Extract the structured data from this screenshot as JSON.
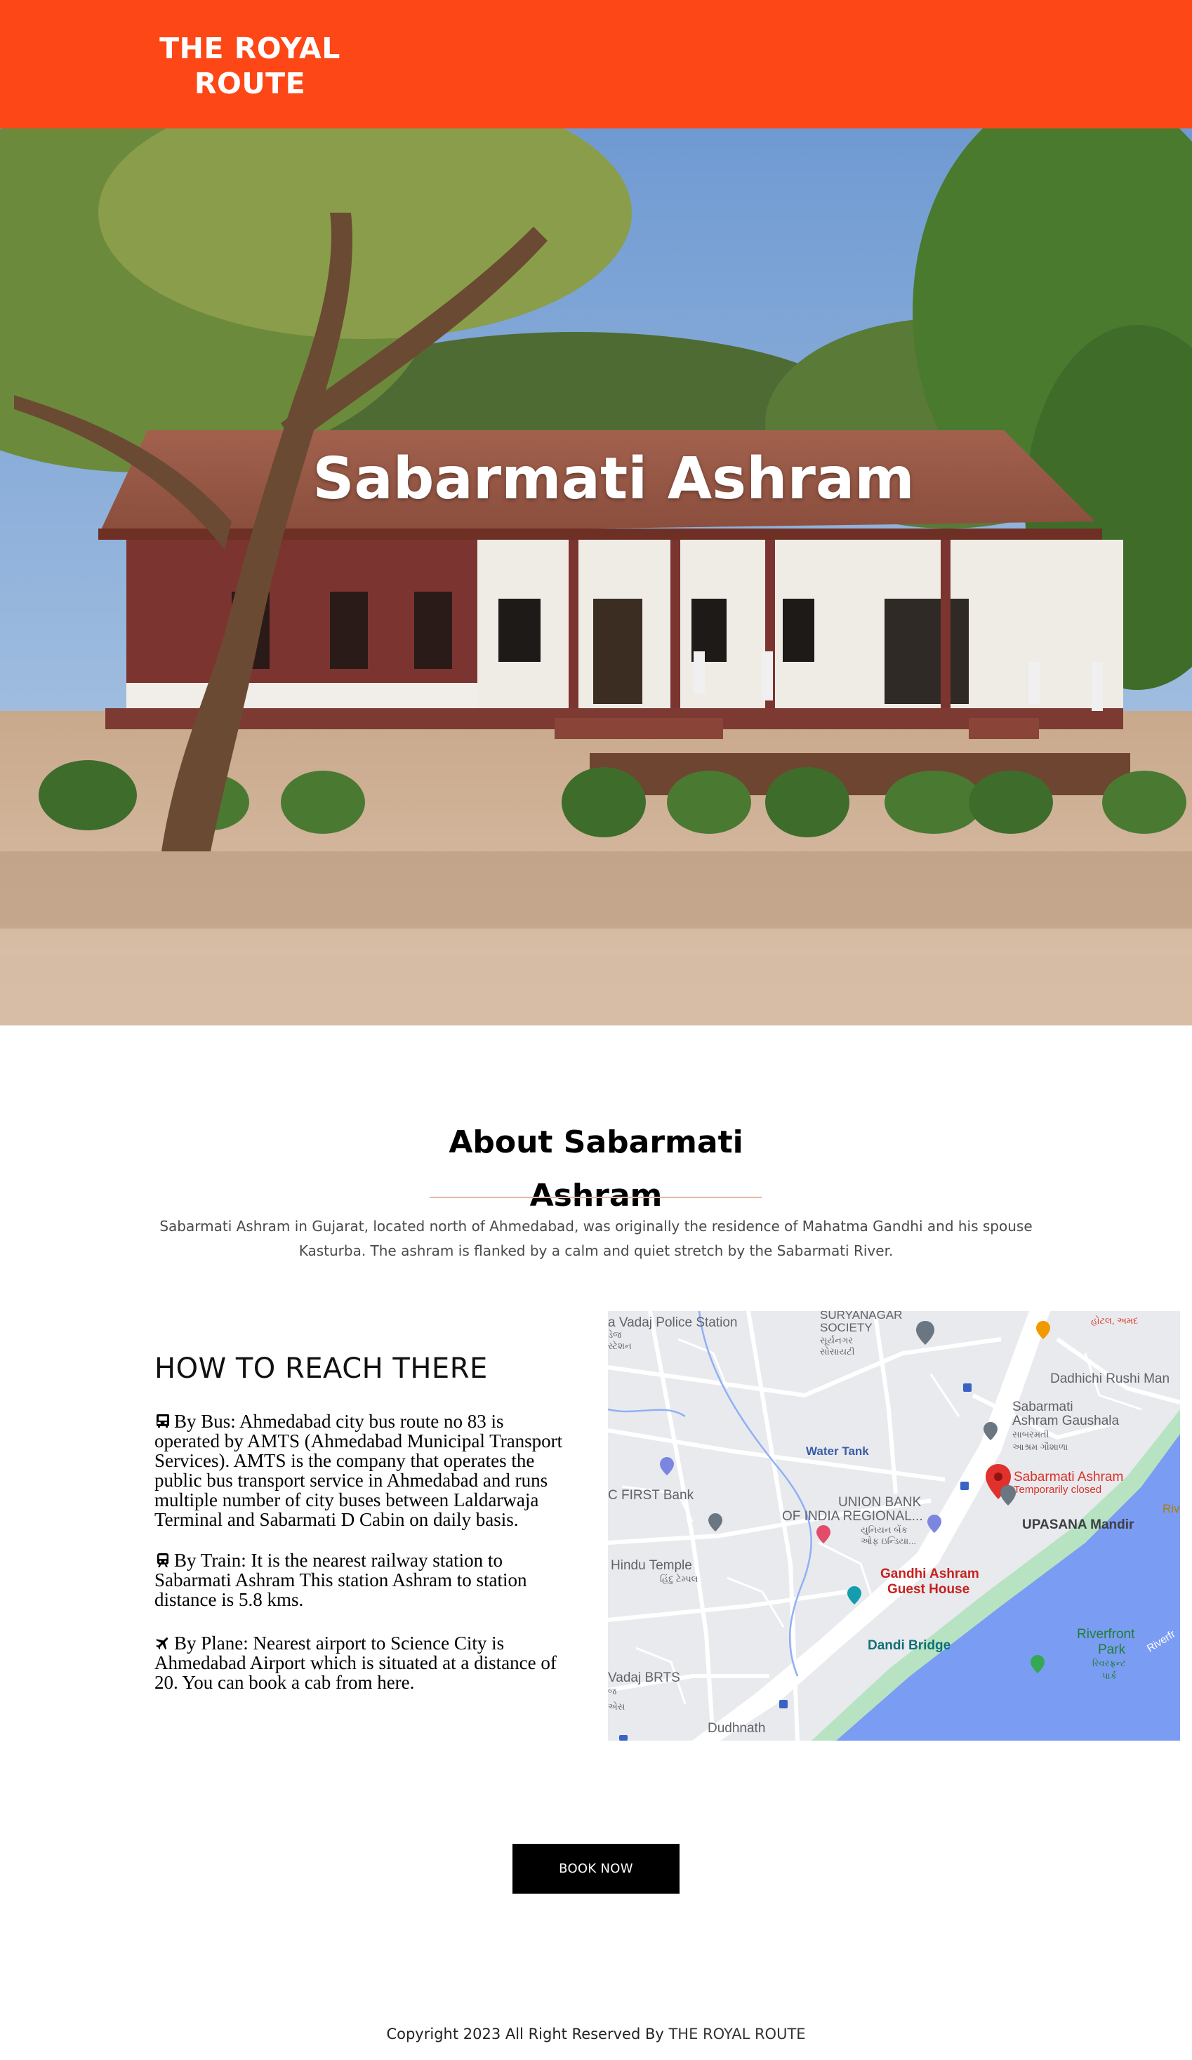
{
  "header": {
    "logo_line1": "THE ROYAL",
    "logo_line2": "ROUTE",
    "background_color": "#fd4716"
  },
  "hero": {
    "title": "Sabarmati Ashram"
  },
  "about": {
    "title_line1": "About Sabarmati",
    "title_line2": "Ashram",
    "text_line1": "Sabarmati Ashram in Gujarat, located north of Ahmedabad, was originally the residence of Mahatma Gandhi and his spouse",
    "text_line2": "Kasturba. The ashram is flanked by a calm and quiet stretch by the Sabarmati River."
  },
  "reach": {
    "title": "HOW TO REACH THERE",
    "items": [
      {
        "icon": "bus-icon",
        "lines": [
          "By Bus:  Ahmedabad city bus route no 83 is",
          "operated by AMTS (Ahmedabad Municipal Transport",
          "Services). AMTS is the company that operates the",
          "public bus transport service in Ahmedabad and runs",
          "multiple number of city buses between Laldarwaja",
          "Terminal and Sabarmati D Cabin on daily basis."
        ]
      },
      {
        "icon": "train-icon",
        "lines": [
          "By Train:  It is the nearest railway station to",
          "Sabarmati Ashram This station Ashram to station",
          "distance is 5.8 kms."
        ]
      },
      {
        "icon": "plane-icon",
        "lines": [
          "By Plane:  Nearest airport to Science City is",
          "Ahmedabad Airport which is situated at a distance of",
          "20. You can book a cab from here."
        ]
      }
    ]
  },
  "map": {
    "labels": {
      "vadaj_police": "a Vadaj Police Station",
      "vadaj_police_gu": "ડેજ",
      "vadaj_police_gu2": "સ્ટેશન",
      "suryanagar": "SURYANAGAR",
      "society": "SOCIETY",
      "suryanagar_gu": "સૂર્યનગર",
      "society_gu": "સોસાયટી",
      "dadhichi": "Dadhichi Rushi Man",
      "gaushala1": "Sabarmati",
      "gaushala2": "Ashram Gaushala",
      "gaushala_gu": "આશ્રમ ગૌશાળા",
      "sabarmati_gu": "સાબરમતી",
      "water_tank": "Water Tank",
      "ashram_pin": "Sabarmati Ashram",
      "ashram_status": "Temporarily closed",
      "first_bank": "C FIRST Bank",
      "union_bank1": "UNION BANK",
      "union_bank2": "OF INDIA REGIONAL...",
      "union_gu1": "યુનિયન બેંક",
      "union_gu2": "ઓફ ઇન્ડિયા...",
      "upasana": "UPASANA Mandir",
      "hindu_temple": "Hindu Temple",
      "hindu_temple_gu": "હિંદુ ટેમ્પલ",
      "gandhi_guest1": "Gandhi Ashram",
      "gandhi_guest2": "Guest House",
      "dandi_bridge": "Dandi Bridge",
      "riverfront1": "Riverfront",
      "riverfront2": "Park",
      "riverfront_gu1": "રિવરફ્રન્ટ",
      "riverfront_gu2": "પાર્ક",
      "riverfront_road": "Riverfr",
      "vadaj_brts": "Vadaj BRTS",
      "vadaj_brts_gu1": "જ",
      "vadaj_brts_gu2": "એસ",
      "dudhnath": "Dudhnath",
      "river_edge": "Riv",
      "top_right_gu": "હોટલ, અમદ"
    },
    "colors": {
      "river": "#7b9cf3",
      "land": "#e9eaee",
      "road": "#ffffff",
      "park": "#b7e3c2",
      "pin": "#e0312c"
    }
  },
  "book": {
    "label": "BOOK NOW"
  },
  "footer": {
    "text": "Copyright 2023 All Right Reserved By",
    "brand": "THE ROYAL ROUTE"
  }
}
